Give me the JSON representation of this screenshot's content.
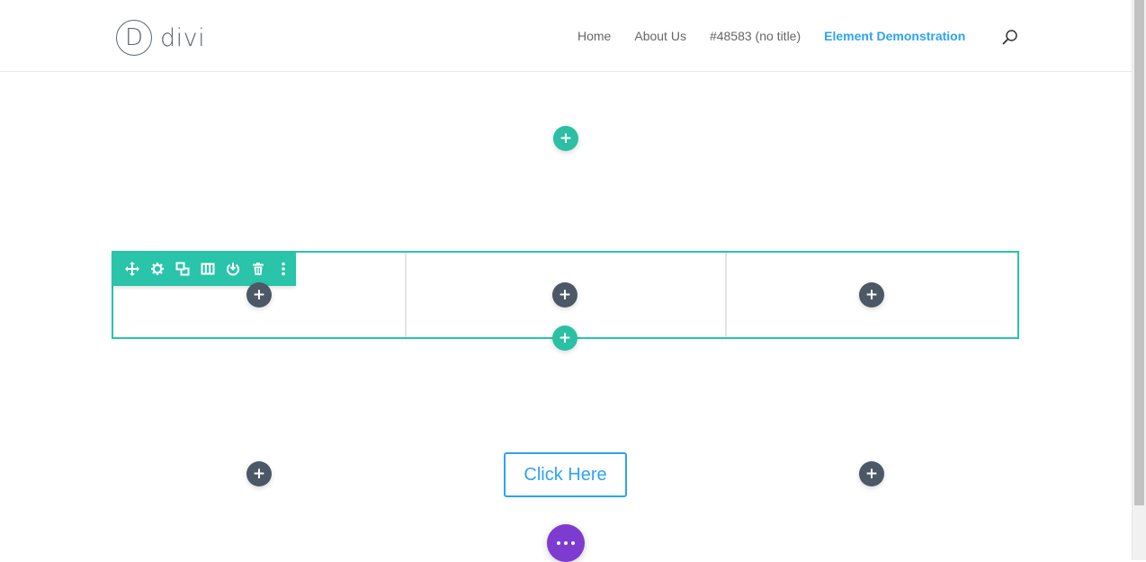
{
  "header": {
    "logo": {
      "mark": "D",
      "text": "divi"
    },
    "nav": [
      "Home",
      "About Us",
      "#48583 (no title)",
      "Element Demonstration"
    ],
    "active_nav": "Element Demonstration",
    "search_icon": "search-icon"
  },
  "builder": {
    "add_symbol": "+",
    "toolbar_icons": [
      "move-icon",
      "gear-icon",
      "duplicate-icon",
      "columns-icon",
      "power-icon",
      "trash-icon",
      "more-vertical-icon"
    ],
    "cta_label": "Click Here",
    "more_icon": "ellipsis-icon"
  },
  "colors": {
    "accent_teal": "#29c4a9",
    "module_dark": "#4c5866",
    "link_blue": "#2ea3f2",
    "purple": "#7e3bd0"
  }
}
